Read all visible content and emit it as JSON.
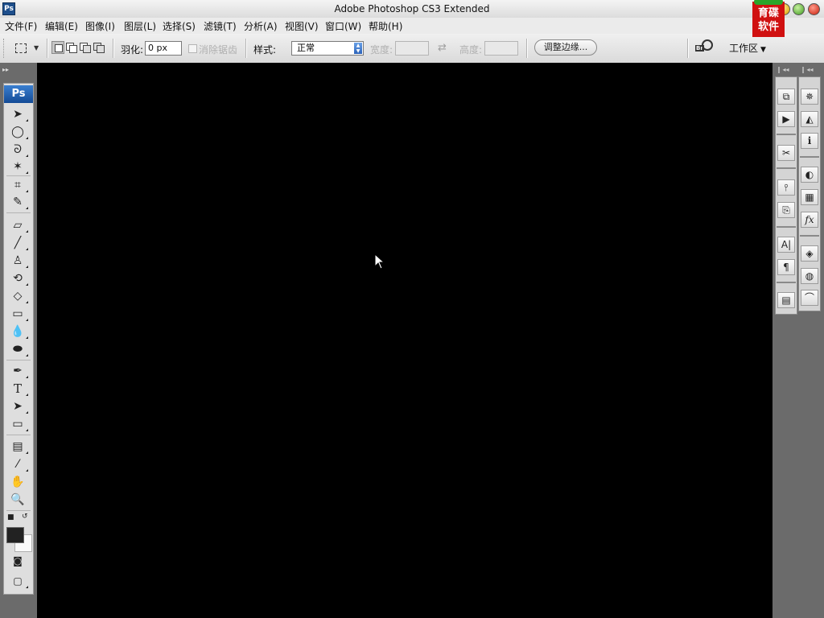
{
  "window": {
    "title": "Adobe Photoshop CS3 Extended",
    "app_badge": "Ps",
    "watermark": "育碟软件"
  },
  "menu": [
    "文件(F)",
    "编辑(E)",
    "图像(I)",
    "图层(L)",
    "选择(S)",
    "滤镜(T)",
    "分析(A)",
    "视图(V)",
    "窗口(W)",
    "帮助(H)"
  ],
  "options": {
    "feather_label": "羽化:",
    "feather_value": "0 px",
    "antialias_label": "消除锯齿",
    "style_label": "样式:",
    "style_value": "正常",
    "width_label": "宽度:",
    "height_label": "高度:",
    "refine_edge_button": "调整边缘...",
    "bridge_label": "Br",
    "workspace_label": "工作区"
  },
  "toolbox": {
    "logo": "Ps",
    "tools": [
      "move",
      "elliptical-marquee",
      "lasso",
      "magic-wand",
      "crop",
      "slice",
      "healing-brush",
      "brush",
      "clone-stamp",
      "history-brush",
      "eraser",
      "gradient",
      "blur",
      "dodge",
      "pen",
      "type",
      "path-selection",
      "rectangle",
      "notes",
      "eyedropper",
      "hand",
      "zoom"
    ],
    "foreground_color": "#1e1e1e",
    "background_color": "#fafafa",
    "type_glyph": "T"
  },
  "canvas": {
    "background": "#000000"
  },
  "dock": {
    "left_column": [
      "history",
      "actions",
      "tool-presets",
      "brushes",
      "clone-source",
      "character",
      "paragraph",
      "layer-comps"
    ],
    "right_column": [
      "navigator",
      "histogram",
      "info",
      "color",
      "swatches",
      "styles",
      "layers",
      "channels",
      "paths"
    ],
    "info_glyph": "i",
    "fx_glyph": "fx",
    "paragraph_glyph": "¶",
    "char_glyph": "A|"
  }
}
